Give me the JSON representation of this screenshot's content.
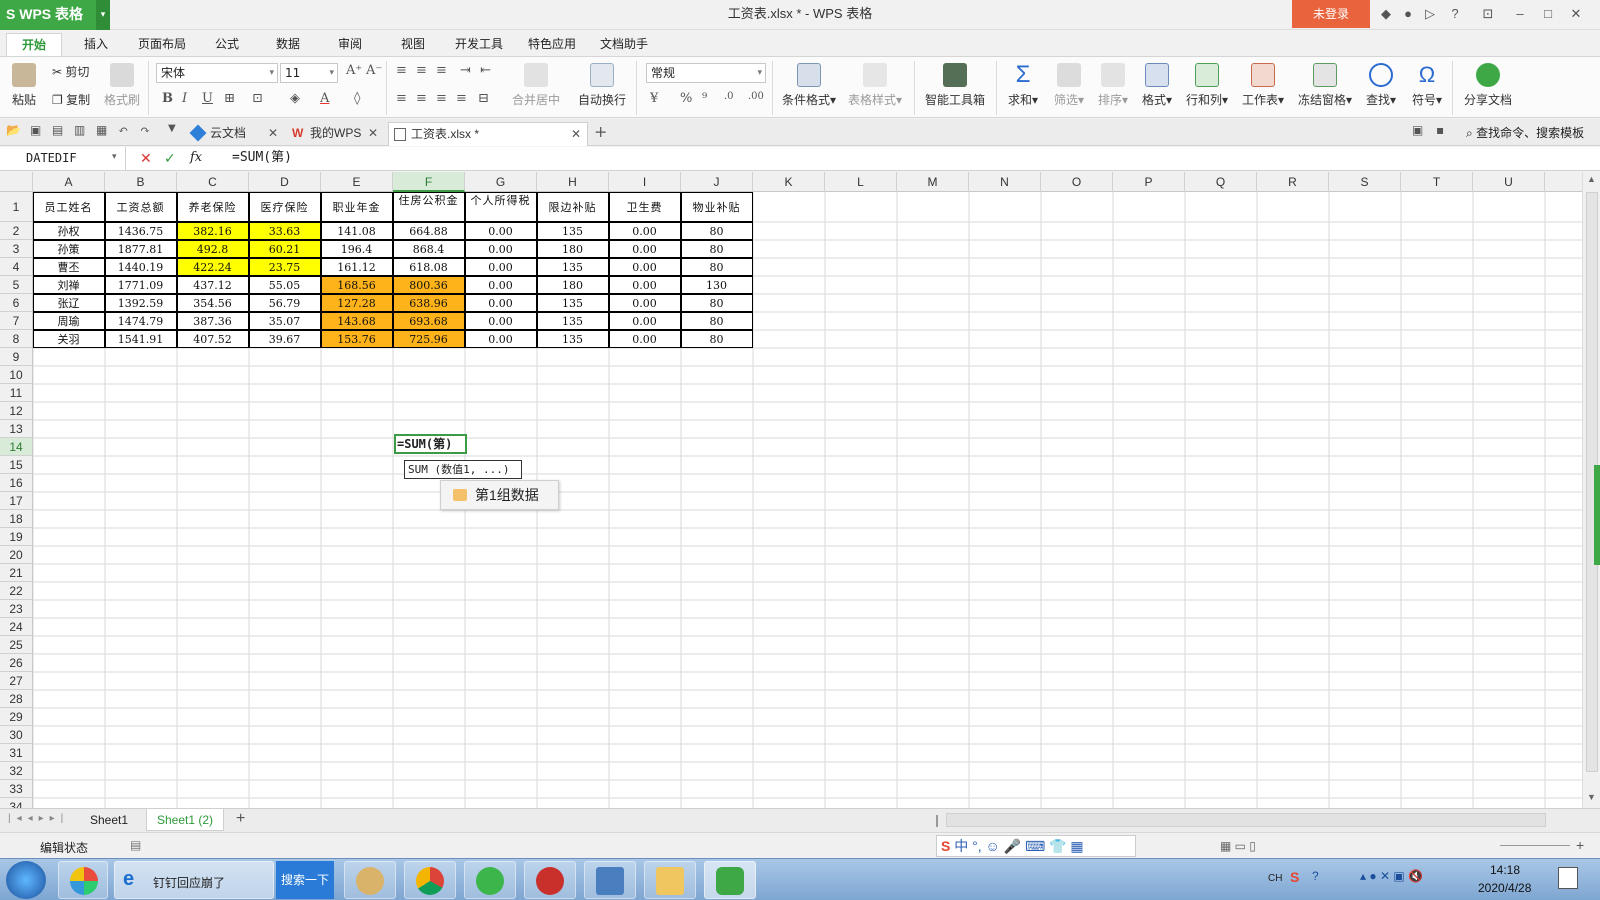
{
  "app": {
    "logo": "S WPS 表格",
    "title": "工资表.xlsx * - WPS 表格",
    "login": "未登录",
    "help": "?"
  },
  "menu": [
    "开始",
    "插入",
    "页面布局",
    "公式",
    "数据",
    "审阅",
    "视图",
    "开发工具",
    "特色应用",
    "文档助手"
  ],
  "ribbon": {
    "paste": "粘贴",
    "cut": "剪切",
    "copy": "复制",
    "format_painter": "格式刷",
    "font_name": "宋体",
    "font_size": "11",
    "merge_center": "合并居中",
    "wrap": "自动换行",
    "number_format": "常规",
    "cond_format": "条件格式",
    "table_style": "表格样式",
    "smart_tools": "智能工具箱",
    "sum": "求和",
    "filter": "筛选",
    "sort": "排序",
    "format": "格式",
    "row_col": "行和列",
    "worksheet": "工作表",
    "freeze": "冻结窗格",
    "find": "查找",
    "symbol": "符号",
    "share": "分享文档",
    "bold": "B",
    "italic": "I",
    "underline": "U",
    "percent": "%",
    "comma": "⁹"
  },
  "doc_tabs": [
    {
      "label": "云文档"
    },
    {
      "label": "我的WPS"
    },
    {
      "label": "工资表.xlsx *"
    }
  ],
  "search_cmd": "查找命令、搜索模板",
  "formula_bar": {
    "name_box": "DATEDIF",
    "fx": "fx",
    "formula": "=SUM(第)"
  },
  "columns": [
    "A",
    "B",
    "C",
    "D",
    "E",
    "F",
    "G",
    "H",
    "I",
    "J",
    "K",
    "L",
    "M",
    "N",
    "O",
    "P",
    "Q",
    "R",
    "S",
    "T",
    "U"
  ],
  "row_numbers": [
    "1",
    "2",
    "3",
    "4",
    "5",
    "6",
    "7",
    "8",
    "9",
    "10",
    "11",
    "12",
    "13",
    "14",
    "15",
    "16",
    "17",
    "18",
    "19",
    "20",
    "21",
    "22",
    "23",
    "24",
    "25",
    "26",
    "27",
    "28",
    "29",
    "30",
    "31",
    "32",
    "33",
    "34"
  ],
  "table": {
    "headers": [
      "员工姓名",
      "工资总额",
      "养老保险",
      "医疗保险",
      "职业年金",
      "住房公积金",
      "个人所得税",
      "限边补贴",
      "卫生费",
      "物业补贴"
    ],
    "rows": [
      [
        "孙权",
        "1436.75",
        "382.16",
        "33.63",
        "141.08",
        "664.88",
        "0.00",
        "135",
        "0.00",
        "80"
      ],
      [
        "孙策",
        "1877.81",
        "492.8",
        "60.21",
        "196.4",
        "868.4",
        "0.00",
        "180",
        "0.00",
        "80"
      ],
      [
        "曹丕",
        "1440.19",
        "422.24",
        "23.75",
        "161.12",
        "618.08",
        "0.00",
        "135",
        "0.00",
        "80"
      ],
      [
        "刘禅",
        "1771.09",
        "437.12",
        "55.05",
        "168.56",
        "800.36",
        "0.00",
        "180",
        "0.00",
        "130"
      ],
      [
        "张辽",
        "1392.59",
        "354.56",
        "56.79",
        "127.28",
        "638.96",
        "0.00",
        "135",
        "0.00",
        "80"
      ],
      [
        "周瑜",
        "1474.79",
        "387.36",
        "35.07",
        "143.68",
        "693.68",
        "0.00",
        "135",
        "0.00",
        "80"
      ],
      [
        "关羽",
        "1541.91",
        "407.52",
        "39.67",
        "153.76",
        "725.96",
        "0.00",
        "135",
        "0.00",
        "80"
      ]
    ],
    "highlight_yellow": "#ffff00",
    "highlight_orange": "#ffb31a"
  },
  "edit_cell": "=SUM(第)",
  "tooltip": "SUM (数值1, ...)",
  "suggestion": "第1组数据",
  "sheets": [
    "Sheet1",
    "Sheet1 (2)"
  ],
  "status": "编辑状态",
  "taskbar": {
    "ie_label": "钉钉回应崩了",
    "search_label": "搜索一下",
    "lang": "CH",
    "time": "14:18",
    "date": "2020/4/28"
  },
  "colors": {
    "accent": "#3ea846",
    "login": "#e9633c"
  }
}
